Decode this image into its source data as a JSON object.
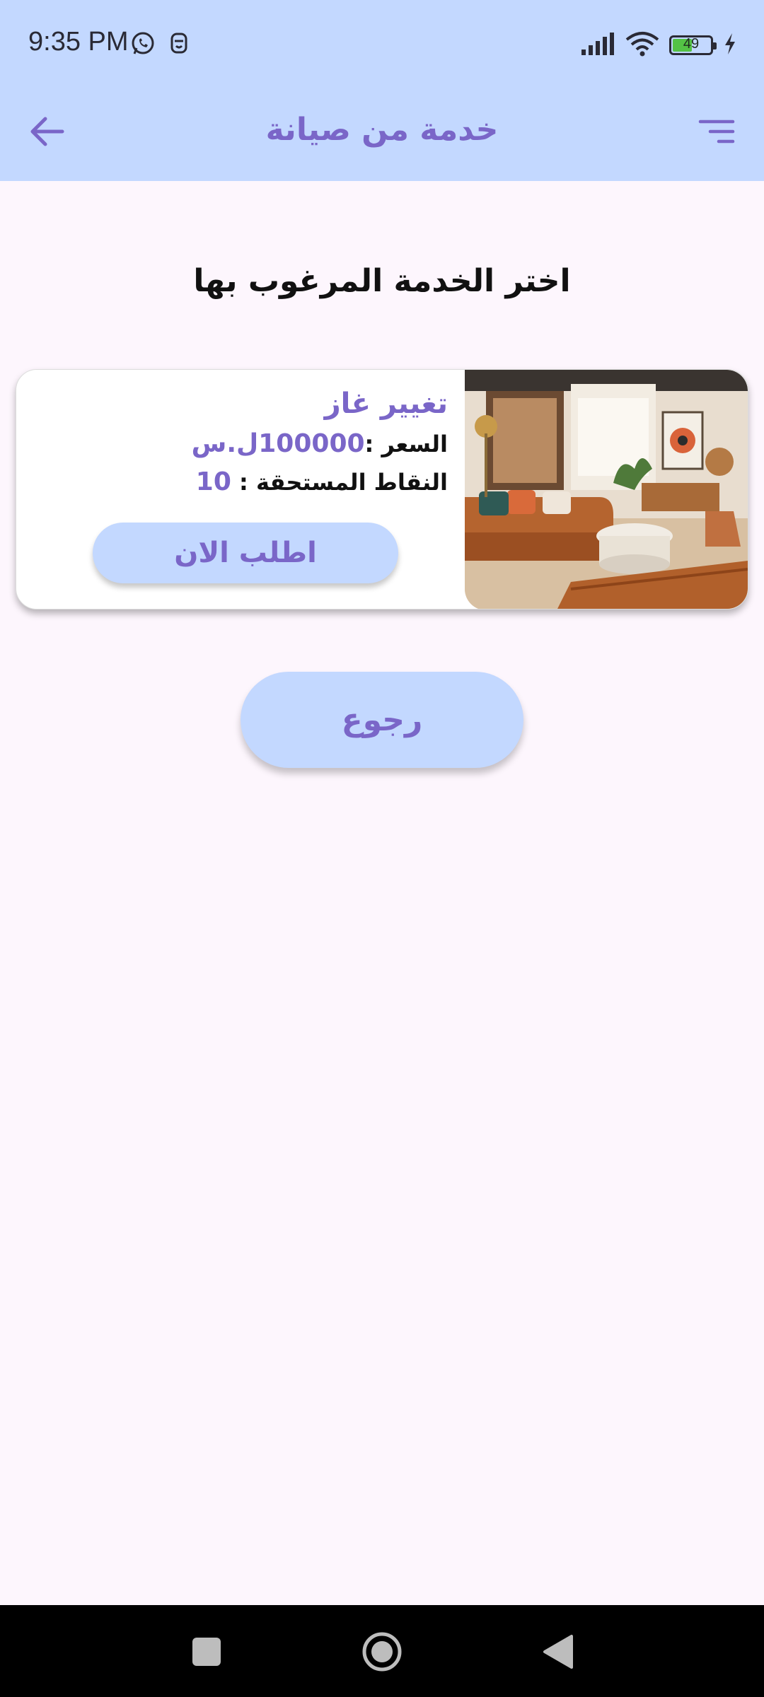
{
  "status_bar": {
    "time": "9:35 PM",
    "left_icons": [
      "whatsapp-icon",
      "notification-icon"
    ],
    "right_icons": [
      "signal-icon",
      "wifi-icon",
      "battery-icon",
      "charging-icon"
    ],
    "battery_level": "49",
    "battery_fraction": 0.49
  },
  "app_bar": {
    "title": "خدمة من صيانة",
    "back_icon": "arrow-left-icon",
    "menu_icon": "filter-menu-icon"
  },
  "main": {
    "heading": "اختر الخدمة المرغوب بها",
    "services": [
      {
        "name": "تغيير غاز",
        "price_label": "السعر :",
        "price_value": "100000ل.س",
        "points_label": "النقاط المستحقة :",
        "points_value": "10",
        "order_label": "اطلب الان",
        "image": "living-room-photo"
      }
    ],
    "return_label": "رجوع"
  },
  "nav_bar": {
    "icons": [
      "recent-apps-icon",
      "home-icon",
      "back-icon"
    ]
  },
  "colors": {
    "bar_bg": "#c3d8ff",
    "accent": "#7a66c8",
    "page_bg": "#fdf6fd"
  }
}
